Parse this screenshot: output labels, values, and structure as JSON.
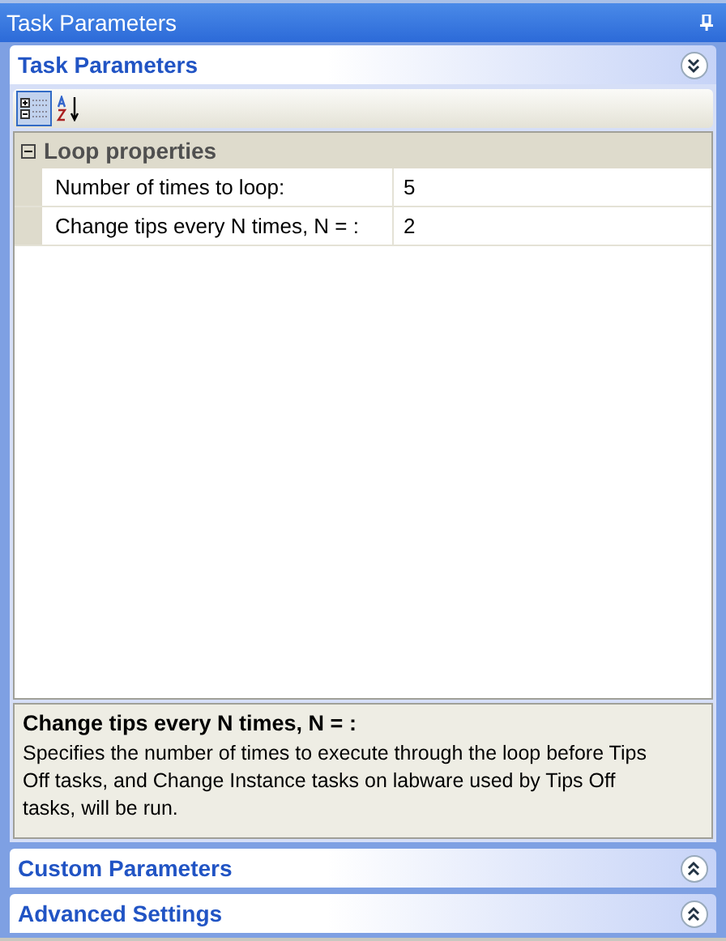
{
  "window": {
    "title": "Task Parameters"
  },
  "sections": [
    {
      "title": "Task Parameters",
      "expanded": true,
      "toolbar": [
        {
          "kind": "categorized",
          "selected": true
        },
        {
          "kind": "alphabetical",
          "selected": false
        }
      ],
      "categories": [
        {
          "title": "Loop properties",
          "expanded": true,
          "rows": [
            {
              "label": "Number of times to loop:",
              "value": "5"
            },
            {
              "label": "Change tips every N times, N = :",
              "value": "2"
            }
          ]
        }
      ],
      "description": {
        "title": "Change tips every N times, N = :",
        "text": "Specifies the number of times to execute through the loop before Tips Off tasks, and Change Instance tasks on labware used by Tips Off tasks, will be run."
      }
    },
    {
      "title": "Custom Parameters",
      "expanded": false
    },
    {
      "title": "Advanced Settings",
      "expanded": false
    }
  ]
}
